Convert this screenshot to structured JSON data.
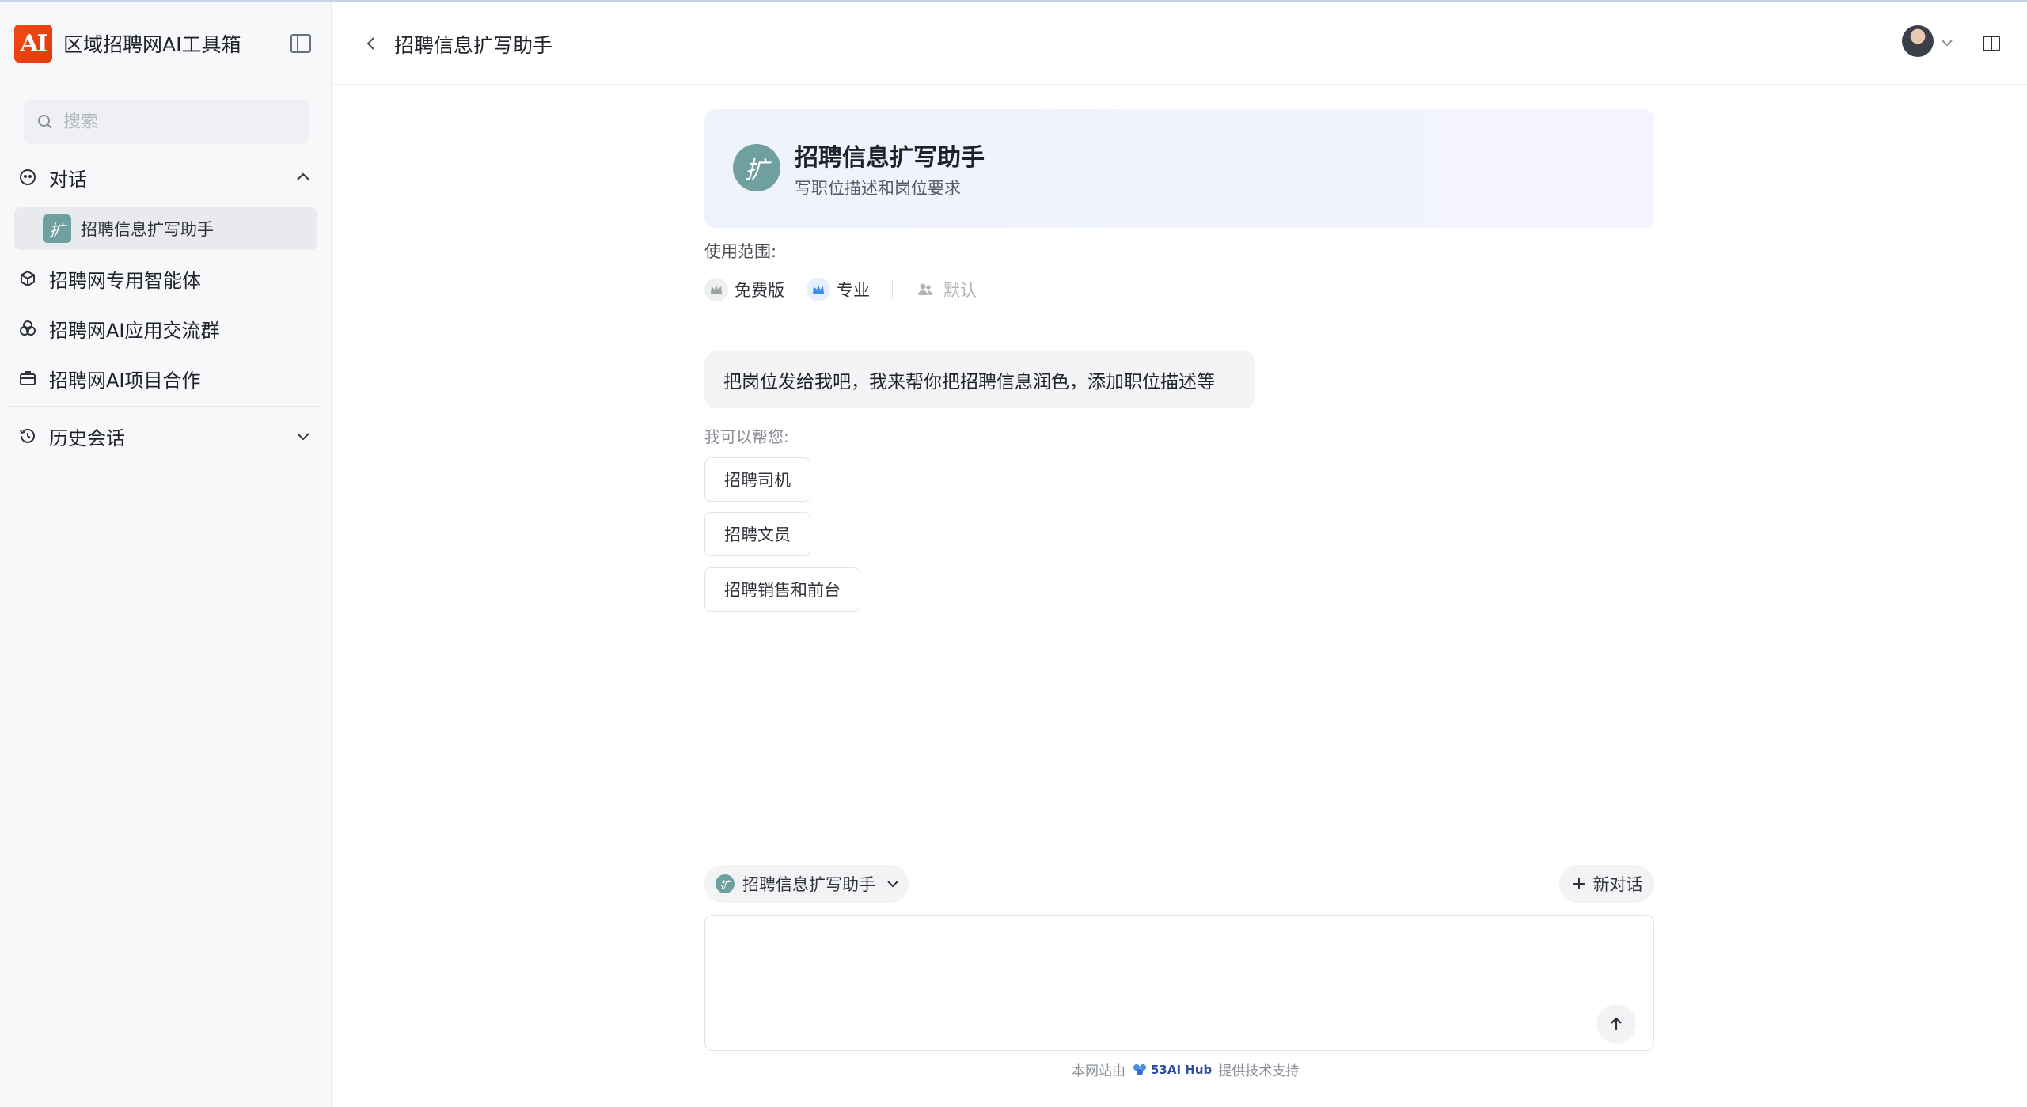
{
  "app": {
    "title": "区域招聘网AI工具箱",
    "logo_text": "AI"
  },
  "sidebar": {
    "search_placeholder": "搜索",
    "sections": {
      "chat": "对话",
      "agents": "招聘网专用智能体",
      "group": "招聘网AI应用交流群",
      "cooperation": "招聘网AI项目合作",
      "history": "历史会话"
    },
    "active_agent": {
      "label": "招聘信息扩写助手",
      "avatar_text": "扩"
    }
  },
  "header": {
    "title": "招聘信息扩写助手"
  },
  "agent_card": {
    "avatar_text": "扩",
    "title": "招聘信息扩写助手",
    "description": "写职位描述和岗位要求"
  },
  "scope": {
    "label": "使用范围:",
    "tags": [
      {
        "label": "免费版",
        "color": "#9aa39c"
      },
      {
        "label": "专业",
        "color": "#3c8cf0"
      },
      {
        "label": "默认",
        "color": "#b1b5bb"
      }
    ]
  },
  "chat": {
    "welcome": "把岗位发给我吧，我来帮你把招聘信息润色，添加职位描述等",
    "help_label": "我可以帮您:",
    "suggestions": [
      "招聘司机",
      "招聘文员",
      "招聘销售和前台"
    ]
  },
  "composer": {
    "agent_selector": "招聘信息扩写助手",
    "new_chat": "新对话",
    "input_value": ""
  },
  "footer": {
    "prefix": "本网站由",
    "brand": "53AI Hub",
    "suffix": "提供技术支持"
  },
  "colors": {
    "brand": "#f04b16",
    "agent_avatar": "#6f9f9e",
    "card_bg": "#eef3fb"
  }
}
